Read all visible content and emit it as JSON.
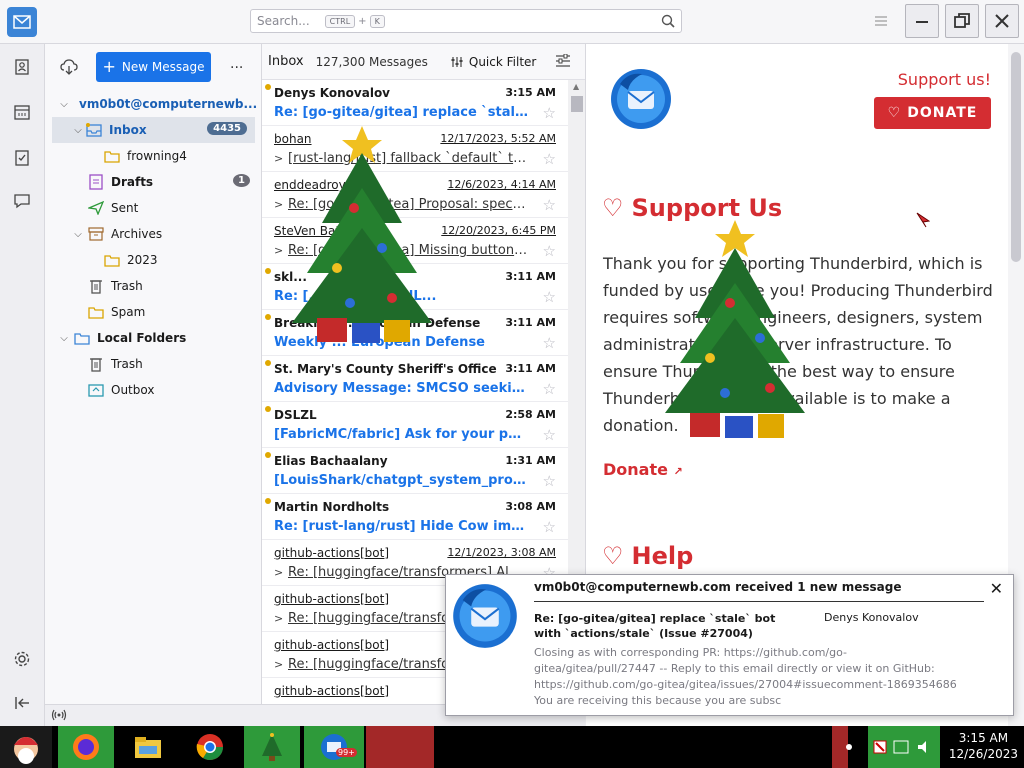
{
  "titlebar": {
    "search_placeholder": "Search...",
    "search_kbd_1": "CTRL",
    "search_kbd_plus": "+",
    "search_kbd_2": "K"
  },
  "folderpane": {
    "new_message": "New Message",
    "more": "...",
    "account": "vm0b0t@computernewb...",
    "folders": [
      {
        "label": "Inbox",
        "badge": "4435"
      },
      {
        "label": "frowning4"
      },
      {
        "label": "Drafts",
        "badge": "1"
      },
      {
        "label": "Sent"
      },
      {
        "label": "Archives"
      },
      {
        "label": "2023"
      },
      {
        "label": "Trash"
      },
      {
        "label": "Spam"
      },
      {
        "label": "Local Folders"
      },
      {
        "label": "Trash"
      },
      {
        "label": "Outbox"
      }
    ]
  },
  "msglist": {
    "title": "Inbox",
    "count": "127,300 Messages",
    "quick_filter": "Quick Filter",
    "rows": [
      {
        "sender": "Denys Konovalov",
        "time": "3:15 AM",
        "subject": "Re: [go-gitea/gitea] replace `stale` bot ...",
        "unread": true
      },
      {
        "sender": "bohan",
        "time": "12/17/2023, 5:52 AM",
        "subject": "[rust-lang/rust] fallback `default` to `Non...",
        "unread": false
      },
      {
        "sender": "enddeadroyal",
        "time": "12/6/2023, 4:14 AM",
        "subject": "Re: [go-gitea/gitea] Proposal: spec: allow ty...",
        "unread": false
      },
      {
        "sender": "SteVen Batten",
        "time": "12/20/2023, 6:45 PM",
        "subject": "Re: [go-gitea/gitea] Missing button h...",
        "unread": false
      },
      {
        "sender": "skl...",
        "time": "3:11 AM",
        "subject": "Re: [...] VirtualizedL...",
        "unread": true
      },
      {
        "sender": "Breaking ... European Defense",
        "time": "3:11 AM",
        "subject": "Weekly ... European Defense",
        "unread": true
      },
      {
        "sender": "St. Mary's County Sheriff's Office",
        "time": "3:11 AM",
        "subject": "Advisory Message: SMCSO seeking the ...",
        "unread": true
      },
      {
        "sender": "DSLZL",
        "time": "2:58 AM",
        "subject": "[FabricMC/fabric] Ask for your permi...",
        "unread": true
      },
      {
        "sender": "Elias Bachaalany",
        "time": "1:31 AM",
        "subject": "[LouisShark/chatgpt_system_prompt]...",
        "unread": true
      },
      {
        "sender": "Martin Nordholts",
        "time": "3:08 AM",
        "subject": "Re: [rust-lang/rust] Hide Cow implem...",
        "unread": true
      },
      {
        "sender": "github-actions[bot]",
        "time": "12/1/2023, 3:08 AM",
        "subject": "Re: [huggingface/transformers] Al...",
        "unread": false
      },
      {
        "sender": "github-actions[bot]",
        "time": "",
        "subject": "Re: [huggingface/transformers]",
        "unread": false
      },
      {
        "sender": "github-actions[bot]",
        "time": "",
        "subject": "Re: [huggingface/transformers]",
        "unread": false
      },
      {
        "sender": "github-actions[bot]",
        "time": "",
        "subject": "",
        "unread": false
      }
    ]
  },
  "reading": {
    "support_link": "Support us!",
    "donate_button": "DONATE",
    "support_title": "Support Us",
    "support_text": "Thank you for supporting Thunderbird, which is funded by users like you! Producing Thunderbird requires software engineers, designers, system administrators and server infrastructure. To ensure Thunderbird, the best way to ensure Thunderbird remains available is to make a donation.",
    "donate_link": "Donate",
    "help_title": "Help"
  },
  "notification": {
    "heading": "vm0b0t@computernewb.com received 1 new message",
    "subject": "Re: [go-gitea/gitea] replace `stale` bot with `actions/stale` (Issue #27004)",
    "from": "Denys Konovalov",
    "body": "Closing as with corresponding PR: https://github.com/go-gitea/gitea/pull/27447 -- Reply to this email directly or view it on GitHub: https://github.com/go-gitea/gitea/issues/27004#issuecomment-1869354686 You are receiving this because you are subsc",
    "close": "✕"
  },
  "taskbar": {
    "time": "3:15 AM",
    "date": "12/26/2023",
    "mail_badge": "99+"
  }
}
